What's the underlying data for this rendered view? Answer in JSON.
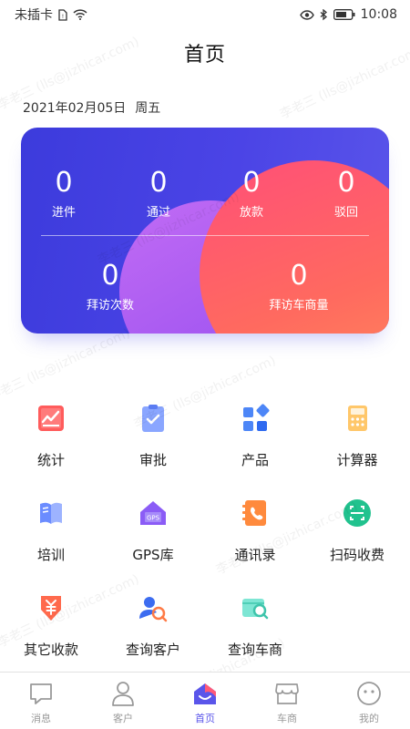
{
  "status_bar": {
    "carrier": "未插卡",
    "time": "10:08"
  },
  "header": {
    "title": "首页"
  },
  "date": {
    "date_text": "2021年02月05日",
    "weekday": "周五"
  },
  "stats": {
    "row1": [
      {
        "value": "0",
        "label": "进件"
      },
      {
        "value": "0",
        "label": "通过"
      },
      {
        "value": "0",
        "label": "放款"
      },
      {
        "value": "0",
        "label": "驳回"
      }
    ],
    "row2": [
      {
        "value": "0",
        "label": "拜访次数"
      },
      {
        "value": "0",
        "label": "拜访车商量"
      }
    ]
  },
  "menu": [
    {
      "label": "统计",
      "icon": "chart-icon"
    },
    {
      "label": "审批",
      "icon": "approval-icon"
    },
    {
      "label": "产品",
      "icon": "product-icon"
    },
    {
      "label": "计算器",
      "icon": "calculator-icon"
    },
    {
      "label": "培训",
      "icon": "book-icon"
    },
    {
      "label": "GPS库",
      "icon": "gps-icon"
    },
    {
      "label": "通讯录",
      "icon": "contacts-icon"
    },
    {
      "label": "扫码收费",
      "icon": "scan-icon"
    },
    {
      "label": "其它收款",
      "icon": "yuan-icon"
    },
    {
      "label": "查询客户",
      "icon": "search-customer-icon"
    },
    {
      "label": "查询车商",
      "icon": "search-dealer-icon"
    }
  ],
  "gps_badge": "GPS",
  "tabs": [
    {
      "label": "消息",
      "icon": "message-icon"
    },
    {
      "label": "客户",
      "icon": "user-icon"
    },
    {
      "label": "首页",
      "icon": "home-icon",
      "active": true
    },
    {
      "label": "车商",
      "icon": "store-icon"
    },
    {
      "label": "我的",
      "icon": "smiley-icon"
    }
  ],
  "watermark": "李老三 (lls@jizhicar.com)",
  "colors": {
    "accent": "#5a55ea",
    "card_blue": "#3c3bdc",
    "card_red": "#ff4f78"
  }
}
